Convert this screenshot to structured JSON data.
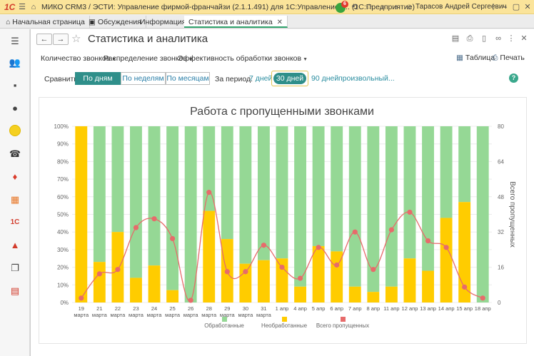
{
  "window": {
    "logo": "1С",
    "title": "МИКО CRM3 / ЭСТИ: Управление фирмой-франчайзи (2.1.1.491) для 1С:Управление т...   (1С:Предприятие)",
    "notification_count": "6",
    "user": "Тарасов Андрей Сергеевич"
  },
  "tabs": [
    {
      "label": "Начальная страница"
    },
    {
      "label": "Обсуждения"
    },
    {
      "label": "Информация"
    },
    {
      "label": "Статистика и аналитика"
    }
  ],
  "page": {
    "title": "Статистика и аналитика"
  },
  "menu": {
    "calls_count": "Количество звонков",
    "calls_distribution": "Распределение звонков",
    "efficiency": "Эффективность обработки звонков",
    "table": "Таблица",
    "print": "Печать"
  },
  "filters": {
    "compare_label": "Сравнить:",
    "by_days": "По дням",
    "by_weeks": "По неделям",
    "by_months": "По месяцам",
    "period_label": "За период:",
    "p7": "7 дней",
    "p30": "30 дней",
    "p90": "90 дней",
    "custom": "произвольный..."
  },
  "colors": {
    "processed": "#95d895",
    "unprocessed": "#ffcc00",
    "total_line": "#e76b6b",
    "accent": "#2f8f8a"
  },
  "chart_data": {
    "type": "bar",
    "stacked_percent": true,
    "title": "Работа с пропущенными звонками",
    "categories": [
      [
        "19",
        "марта"
      ],
      [
        "21",
        "марта"
      ],
      [
        "22",
        "марта"
      ],
      [
        "23",
        "марта"
      ],
      [
        "24",
        "марта"
      ],
      [
        "25",
        "марта"
      ],
      [
        "26",
        "марта"
      ],
      [
        "28",
        "марта"
      ],
      [
        "29",
        "марта"
      ],
      [
        "30",
        "марта"
      ],
      [
        "31",
        "марта"
      ],
      [
        "1 апр"
      ],
      [
        "4 апр"
      ],
      [
        "5 апр"
      ],
      [
        "6 апр"
      ],
      [
        "7 апр"
      ],
      [
        "8 апр"
      ],
      [
        "11 апр"
      ],
      [
        "12 апр"
      ],
      [
        "13 апр"
      ],
      [
        "14 апр"
      ],
      [
        "15 апр"
      ],
      [
        "18 апр"
      ]
    ],
    "y_left": {
      "min": 0,
      "max": 100,
      "ticks": [
        "0%",
        "10%",
        "20%",
        "30%",
        "40%",
        "50%",
        "60%",
        "70%",
        "80%",
        "90%",
        "100%"
      ]
    },
    "y_right": {
      "min": 0,
      "max": 80,
      "ticks": [
        "0",
        "16",
        "32",
        "48",
        "64",
        "80"
      ],
      "label": "Всего пропущенных"
    },
    "series": [
      {
        "name": "Обработанные",
        "values": [
          0,
          77,
          60,
          86,
          79,
          93,
          100,
          48,
          64,
          78,
          76,
          75,
          91,
          68,
          71,
          91,
          94,
          91,
          75,
          82,
          52,
          43,
          100
        ]
      },
      {
        "name": "Необработанные",
        "values": [
          100,
          23,
          40,
          14,
          21,
          7,
          0,
          52,
          36,
          22,
          24,
          25,
          9,
          32,
          29,
          9,
          6,
          9,
          25,
          18,
          48,
          57,
          0
        ]
      },
      {
        "name": "Всего пропущенных",
        "axis": "right",
        "values": [
          2,
          13,
          15,
          34,
          38,
          29,
          1,
          50,
          14,
          14,
          26,
          16,
          11,
          25,
          17,
          32,
          15,
          33,
          41,
          28,
          25,
          7,
          2
        ]
      }
    ],
    "grid": true,
    "legend": "bottom"
  }
}
